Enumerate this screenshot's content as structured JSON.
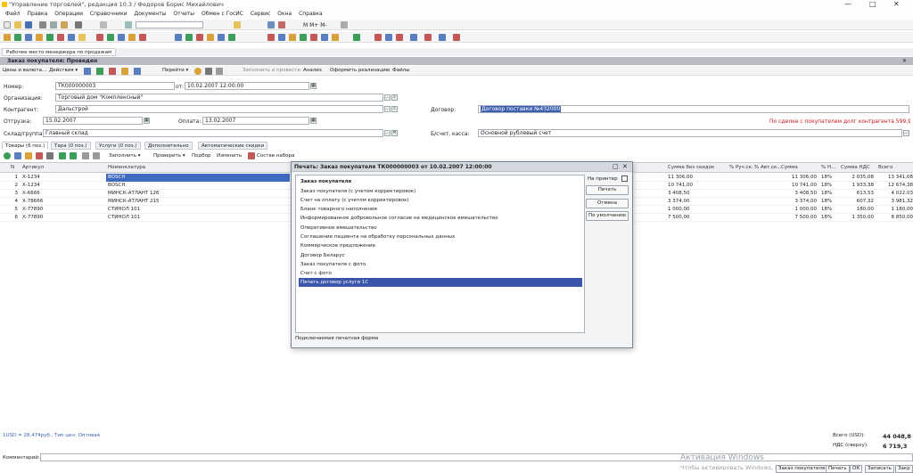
{
  "window": {
    "title": "\"Управление торговлей\", редакция 10.3 / Федоров Борис Михайлович",
    "minimize": "—",
    "maximize": "□",
    "close": "✕"
  },
  "menu": [
    "Файл",
    "Правка",
    "Операции",
    "Справочники",
    "Документы",
    "Отчеты",
    "Обмен с ГосИС",
    "Сервис",
    "Окна",
    "Справка"
  ],
  "open_tab": "Рабочее место менеджера по продажам",
  "form": {
    "title": "Заказ покупателя: Проведен",
    "toolbar": {
      "prices": "Цены и валюта...",
      "actions": "Действия ▾",
      "goto": "Перейти ▾",
      "fill_post": "Заполнить и провести",
      "analysis": "Анализ",
      "realization": "Оформить реализацию",
      "files": "Файлы"
    },
    "number_label": "Номер:",
    "number": "ТК000000003",
    "from_label": "от:",
    "date": "10.02.2007 12:00:00",
    "org_label": "Организация:",
    "org": "Торговый дом \"Комплексный\"",
    "contractor_label": "Контрагент:",
    "contractor": "Дальстрой",
    "contract_label": "Договор:",
    "contract": "Договор поставки №432000",
    "shipment_label": "Отгрузка:",
    "shipment": "15.02.2007",
    "payment_label": "Оплата:",
    "payment": "13.02.2007",
    "debt_note": "По сделке с покупателем долг контрагента 599,90 USD",
    "warehouse_label": "Склад/группа:",
    "warehouse": "Главный склад",
    "account_label": "Б/счет, касса:",
    "account": "Основной рублевый счет"
  },
  "tabs": [
    "Товары (6 поз.)",
    "Тара (0 поз.)",
    "Услуги (0 поз.)",
    "Дополнительно",
    "Автоматические скидки"
  ],
  "table_toolbar": {
    "fill": "Заполнить ▾",
    "check": "Проверить ▾",
    "select": "Подбор",
    "edit": "Изменить",
    "kit": "Состав набора"
  },
  "columns": {
    "n": "N",
    "article": "Артикул",
    "nomenclature": "Номенклатура",
    "sum_no_disc": "Сумма без скидок",
    "manual": "% Руч.ск...",
    "auto": "% Авт.ск...",
    "sum": "Сумма",
    "vat_pct": "% Н...",
    "vat_sum": "Сумма НДС",
    "total": "Всего"
  },
  "rows": [
    {
      "n": "1",
      "article": "Х-1234",
      "name": "BOSCH",
      "sum_no_disc": "11 306,00",
      "sum": "11 306,00",
      "vat": "18%",
      "vat_sum": "2 035,08",
      "total": "13 341,08"
    },
    {
      "n": "2",
      "article": "Х-1234",
      "name": "BOSCH",
      "sum_no_disc": "10 741,00",
      "sum": "10 741,00",
      "vat": "18%",
      "vat_sum": "1 933,38",
      "total": "12 674,38"
    },
    {
      "n": "3",
      "article": "Х-6666",
      "name": "МИНСК-АТЛАНТ 126",
      "sum_no_disc": "3 408,50",
      "sum": "3 408,50",
      "vat": "18%",
      "vat_sum": "613,53",
      "total": "4 022,03"
    },
    {
      "n": "4",
      "article": "Х-78666",
      "name": "МИНСК-АТЛАНТ 215",
      "sum_no_disc": "3 374,00",
      "sum": "3 374,00",
      "vat": "18%",
      "vat_sum": "607,32",
      "total": "3 981,32"
    },
    {
      "n": "5",
      "article": "Х-77890",
      "name": "СТИНОЛ 101",
      "sum_no_disc": "1 000,00",
      "sum": "1 000,00",
      "vat": "18%",
      "vat_sum": "180,00",
      "total": "1 180,00"
    },
    {
      "n": "6",
      "article": "Х-77890",
      "name": "СТИНОЛ 101",
      "sum_no_disc": "7 500,00",
      "sum": "7 500,00",
      "vat": "18%",
      "vat_sum": "1 350,00",
      "total": "8 850,00"
    }
  ],
  "dialog": {
    "title": "Печать: Заказ покупателя ТК000000003 от 10.02.2007 12:00:00",
    "items": [
      "Заказ покупателя",
      "Заказ покупателя (с учетом корректировок)",
      "Счет на оплату (с учетом корректировок)",
      "Бланк товарного наполнения",
      "Информированное добровольное согласие на медицинское вмешательство",
      "Оперативное вмешательство",
      "Соглашение пациента на обработку персональных данных",
      "Коммерческое предложение",
      "Договор Беларус",
      "Заказ покупателя с фото",
      "Счет с фото",
      "Печать договор услуги 1С"
    ],
    "selected_index": 11,
    "to_printer": "На принтер",
    "print": "Печать",
    "cancel": "Отмена",
    "default": "По умолчанию",
    "footer": "Подключаемая печатная форма"
  },
  "footer": {
    "rate": "1USD = 28,474руб., Тип цен: Оптовая",
    "total_label": "Всего (USD):",
    "total": "44 048,8",
    "vat_label": "НДС (сверху):",
    "vat": "6 719,3",
    "comment_label": "Комментарий:"
  },
  "status_buttons": [
    "Заказ покупателя",
    "Печать",
    "ОК",
    "Записать",
    "Закр"
  ],
  "watermark": {
    "title": "Активация Windows",
    "subtitle": "Чтобы активировать Windows, пере..."
  }
}
